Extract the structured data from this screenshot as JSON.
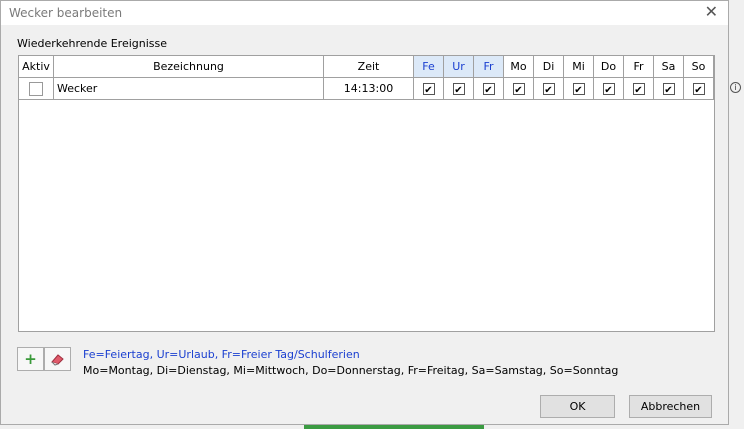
{
  "window": {
    "title": "Wecker bearbeiten"
  },
  "group": {
    "label": "Wiederkehrende Ereignisse"
  },
  "table": {
    "headers": {
      "aktiv": "Aktiv",
      "name": "Bezeichnung",
      "zeit": "Zeit"
    },
    "days": [
      {
        "label": "Fe",
        "highlighted": true
      },
      {
        "label": "Ur",
        "highlighted": true
      },
      {
        "label": "Fr",
        "highlighted": true
      },
      {
        "label": "Mo",
        "highlighted": false
      },
      {
        "label": "Di",
        "highlighted": false
      },
      {
        "label": "Mi",
        "highlighted": false
      },
      {
        "label": "Do",
        "highlighted": false
      },
      {
        "label": "Fr",
        "highlighted": false
      },
      {
        "label": "Sa",
        "highlighted": false
      },
      {
        "label": "So",
        "highlighted": false
      }
    ],
    "rows": [
      {
        "aktiv": false,
        "name": "Wecker",
        "zeit": "14:13:00",
        "days": [
          true,
          true,
          true,
          true,
          true,
          true,
          true,
          true,
          true,
          true
        ]
      }
    ]
  },
  "legend": {
    "line1": "Fe=Feiertag, Ur=Urlaub, Fr=Freier Tag/Schulferien",
    "line2": "Mo=Montag, Di=Dienstag, Mi=Mittwoch, Do=Donnerstag, Fr=Freitag, Sa=Samstag, So=Sonntag"
  },
  "buttons": {
    "ok": "OK",
    "cancel": "Abbrechen"
  },
  "colors": {
    "accent": "#1a3fd0",
    "header_highlight": "#dce9f8",
    "add_icon": "#3a9a3a"
  },
  "icons": {
    "close": "close-icon",
    "add": "plus-icon",
    "delete": "eraser-icon"
  }
}
